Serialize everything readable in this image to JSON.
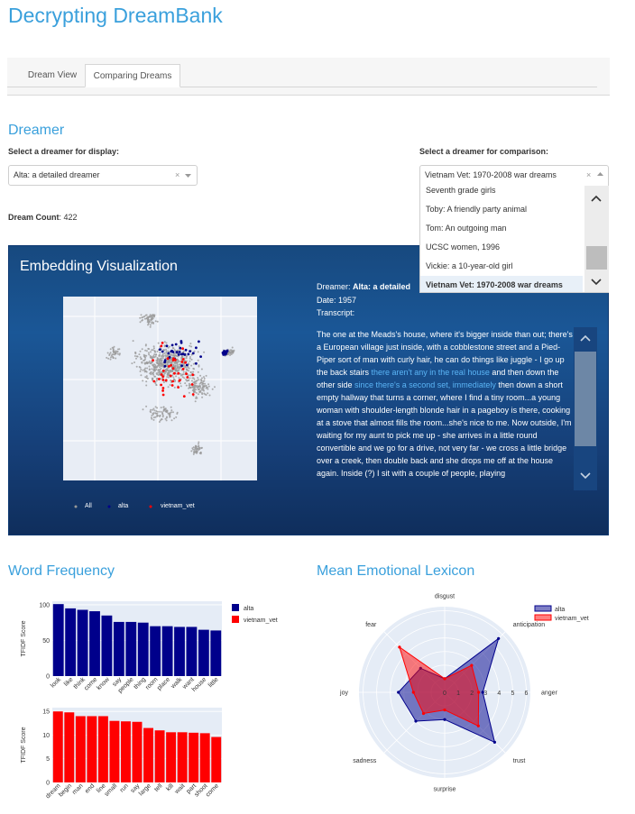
{
  "app": {
    "title": "Decrypting DreamBank"
  },
  "tabs": [
    {
      "label": "Dream View",
      "active": false
    },
    {
      "label": "Comparing Dreams",
      "active": true
    }
  ],
  "dreamer_section": {
    "title": "Dreamer",
    "primary_label": "Select a dreamer for display:",
    "primary_value": "Alta: a detailed dreamer",
    "comparison_label": "Select a dreamer for comparison:",
    "comparison_value": "Vietnam Vet: 1970-2008 war dreams",
    "clear_symbol": "×",
    "dropdown_options": [
      {
        "label": "Seventh grade girls",
        "selected": false
      },
      {
        "label": "Toby: A friendly party animal",
        "selected": false
      },
      {
        "label": "Tom: An outgoing man",
        "selected": false
      },
      {
        "label": "UCSC women, 1996",
        "selected": false
      },
      {
        "label": "Vickie: a 10-year-old girl",
        "selected": false
      },
      {
        "label": "Vietnam Vet: 1970-2008 war dreams",
        "selected": true
      }
    ],
    "count_label": "Dream Count",
    "count_value": ": 422"
  },
  "embedding": {
    "title": "Embedding Visualization",
    "legend": [
      {
        "label": "All",
        "color": "#999999"
      },
      {
        "label": "alta",
        "color": "#00008b"
      },
      {
        "label": "vietnam_vet",
        "color": "#ff0000"
      }
    ],
    "dreamer_label": "Dreamer:",
    "dreamer_value": "Alta: a detailed",
    "date_label": "Date:",
    "date_value": "1957",
    "transcript_label": "Transcript:",
    "transcript_parts": [
      {
        "text": "The one at the Meads's house, where it's bigger inside than out; there's a European village just inside, with a cobblestone street and a Pied-Piper sort of man with curly hair, he can do things like juggle - I go up the back stairs ",
        "hl": false
      },
      {
        "text": "there aren't any in the real house",
        "hl": true
      },
      {
        "text": " and then down the other side ",
        "hl": false
      },
      {
        "text": "since there's a second set, immediately",
        "hl": true
      },
      {
        "text": " then down a short empty hallway that turns a corner, where I find a tiny room...a young woman with shoulder-length blonde hair in a pageboy is there, cooking at a stove that almost fills the room...she's nice to me. Now outside, I'm waiting for my aunt to pick me up - she arrives in a little round convertible and we go for a drive, not very far - we cross a little bridge over a creek, then double back and she drops me off at the house again. Inside (?) I sit with a couple of people, playing",
        "hl": false
      }
    ]
  },
  "word_frequency": {
    "title": "Word Frequency",
    "legend": [
      {
        "label": "alta",
        "color": "#00008b"
      },
      {
        "label": "vietnam_vet",
        "color": "#ff0000"
      }
    ]
  },
  "emotional": {
    "title": "Mean Emotional Lexicon"
  },
  "chart_data": [
    {
      "type": "bar",
      "series_name": "alta",
      "color": "#00008b",
      "ylabel": "TFIDF Score",
      "ylim": [
        0,
        105
      ],
      "yticks": [
        0,
        50,
        100
      ],
      "categories": [
        "look",
        "like",
        "think",
        "come",
        "know",
        "say",
        "people",
        "thing",
        "room",
        "place",
        "walk",
        "want",
        "house",
        "little"
      ],
      "values": [
        101,
        95,
        93,
        91,
        85,
        76,
        76,
        75,
        70,
        70,
        69,
        69,
        65,
        64
      ]
    },
    {
      "type": "bar",
      "series_name": "vietnam_vet",
      "color": "#ff0000",
      "ylabel": "TFIDF Score",
      "ylim": [
        0,
        15.8
      ],
      "yticks": [
        0,
        5,
        10,
        15
      ],
      "categories": [
        "dream",
        "begin",
        "man",
        "end",
        "line",
        "small",
        "run",
        "say",
        "large",
        "tell",
        "kill",
        "wait",
        "part",
        "shoot",
        "come"
      ],
      "values": [
        15,
        14.8,
        14,
        14,
        14,
        13,
        12.9,
        12.8,
        11.5,
        11,
        10.6,
        10.6,
        10.5,
        10.4,
        9.6
      ]
    },
    {
      "type": "radar",
      "axes": [
        "disgust",
        "anticipation",
        "anger",
        "trust",
        "surprise",
        "sadness",
        "joy",
        "fear"
      ],
      "rticks": [
        0,
        1,
        2,
        3,
        4,
        5,
        6
      ],
      "rmax": 6.3,
      "series": [
        {
          "name": "alta",
          "color": "#00008b",
          "values": [
            1.0,
            5.6,
            2.8,
            5.2,
            2.0,
            3.0,
            3.4,
            2.5
          ]
        },
        {
          "name": "vietnam_vet",
          "color": "#ff0000",
          "values": [
            1.0,
            2.8,
            2.5,
            3.5,
            1.3,
            2.2,
            2.3,
            4.7
          ]
        }
      ]
    }
  ]
}
